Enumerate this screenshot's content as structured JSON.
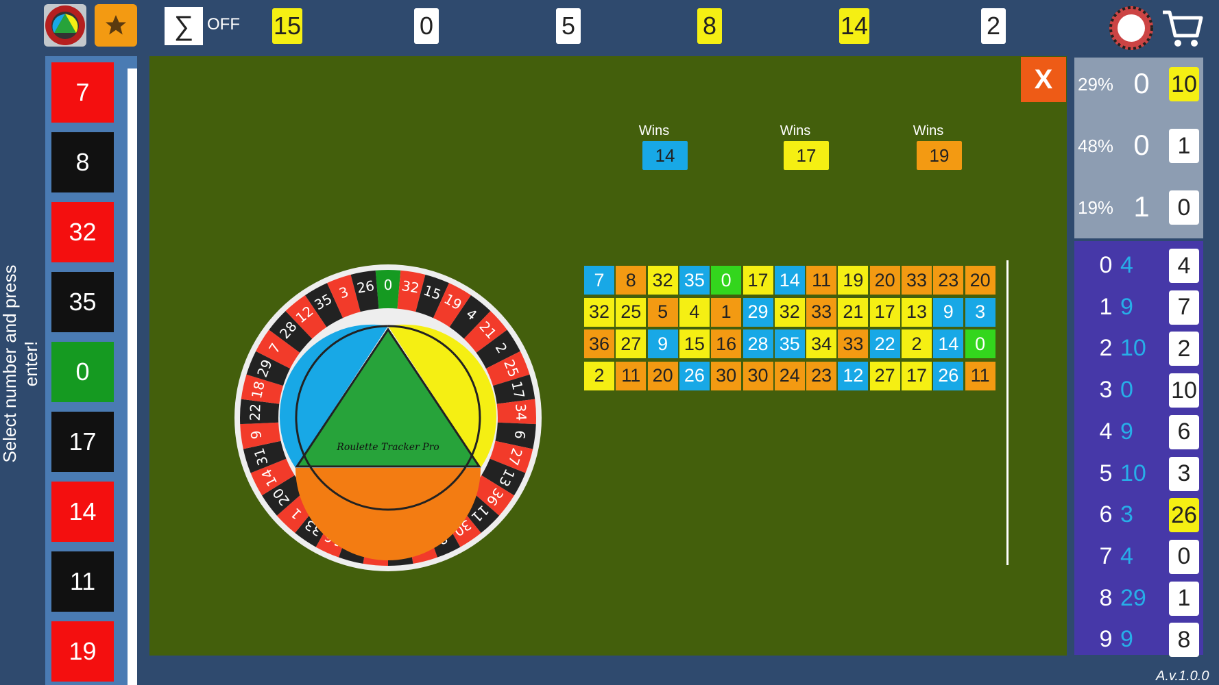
{
  "colors": {
    "red": "#f40f0f",
    "black": "#111111",
    "green": "#159a21",
    "yellow": "#f5ef13",
    "orange": "#f39a12",
    "blue": "#18a8e6",
    "bright_green": "#33d61d",
    "board": "#435f0c",
    "close": "#ee5b16"
  },
  "topbar": {
    "sum_symbol": "∑",
    "sum_state": "OFF",
    "numbers": [
      {
        "value": "15",
        "color": "#f5ef13"
      },
      {
        "value": "0",
        "color": "#ffffff"
      },
      {
        "value": "5",
        "color": "#ffffff"
      },
      {
        "value": "8",
        "color": "#f5ef13"
      },
      {
        "value": "14",
        "color": "#f5ef13"
      },
      {
        "value": "2",
        "color": "#ffffff"
      }
    ]
  },
  "left": {
    "hint": "Select number and press enter!",
    "numbers": [
      {
        "value": "7",
        "color": "#f40f0f"
      },
      {
        "value": "8",
        "color": "#111111"
      },
      {
        "value": "32",
        "color": "#f40f0f"
      },
      {
        "value": "35",
        "color": "#111111"
      },
      {
        "value": "0",
        "color": "#159a21"
      },
      {
        "value": "17",
        "color": "#111111"
      },
      {
        "value": "14",
        "color": "#f40f0f"
      },
      {
        "value": "11",
        "color": "#111111"
      },
      {
        "value": "19",
        "color": "#f40f0f"
      }
    ]
  },
  "board": {
    "close_label": "X",
    "wheel_text": "Roulette Tracker Pro",
    "wins": [
      {
        "label": "Wins",
        "value": "14",
        "color": "#18a8e6"
      },
      {
        "label": "Wins",
        "value": "17",
        "color": "#f5ef13"
      },
      {
        "label": "Wins",
        "value": "19",
        "color": "#f39a12"
      }
    ],
    "grid": [
      [
        [
          "7",
          "b"
        ],
        [
          "8",
          "o"
        ],
        [
          "32",
          "y"
        ],
        [
          "35",
          "b"
        ],
        [
          "0",
          "g"
        ],
        [
          "17",
          "y"
        ],
        [
          "14",
          "b"
        ],
        [
          "11",
          "o"
        ],
        [
          "19",
          "y"
        ],
        [
          "20",
          "o"
        ],
        [
          "33",
          "o"
        ],
        [
          "23",
          "o"
        ],
        [
          "20",
          "o"
        ]
      ],
      [
        [
          "32",
          "y"
        ],
        [
          "25",
          "y"
        ],
        [
          "5",
          "o"
        ],
        [
          "4",
          "y"
        ],
        [
          "1",
          "o"
        ],
        [
          "29",
          "b"
        ],
        [
          "32",
          "y"
        ],
        [
          "33",
          "o"
        ],
        [
          "21",
          "y"
        ],
        [
          "17",
          "y"
        ],
        [
          "13",
          "y"
        ],
        [
          "9",
          "b"
        ],
        [
          "3",
          "b"
        ]
      ],
      [
        [
          "36",
          "o"
        ],
        [
          "27",
          "y"
        ],
        [
          "9",
          "b"
        ],
        [
          "15",
          "y"
        ],
        [
          "16",
          "o"
        ],
        [
          "28",
          "b"
        ],
        [
          "35",
          "b"
        ],
        [
          "34",
          "y"
        ],
        [
          "33",
          "o"
        ],
        [
          "22",
          "b"
        ],
        [
          "2",
          "y"
        ],
        [
          "14",
          "b"
        ],
        [
          "0",
          "g"
        ]
      ],
      [
        [
          "2",
          "y"
        ],
        [
          "11",
          "o"
        ],
        [
          "20",
          "o"
        ],
        [
          "26",
          "b"
        ],
        [
          "30",
          "o"
        ],
        [
          "30",
          "o"
        ],
        [
          "24",
          "o"
        ],
        [
          "23",
          "o"
        ],
        [
          "12",
          "b"
        ],
        [
          "27",
          "y"
        ],
        [
          "17",
          "y"
        ],
        [
          "26",
          "b"
        ],
        [
          "11",
          "o"
        ]
      ]
    ]
  },
  "stats": {
    "top": [
      {
        "pct": "29%",
        "value": "0",
        "box": "10",
        "box_color": "#f5ef13"
      },
      {
        "pct": "48%",
        "value": "0",
        "box": "1",
        "box_color": "#ffffff"
      },
      {
        "pct": "19%",
        "value": "1",
        "box": "0",
        "box_color": "#ffffff"
      }
    ],
    "digits": [
      {
        "d": "0",
        "count": "4",
        "box": "4",
        "box_color": "#ffffff"
      },
      {
        "d": "1",
        "count": "9",
        "box": "7",
        "box_color": "#ffffff"
      },
      {
        "d": "2",
        "count": "10",
        "box": "2",
        "box_color": "#ffffff"
      },
      {
        "d": "3",
        "count": "0",
        "box": "10",
        "box_color": "#ffffff"
      },
      {
        "d": "4",
        "count": "9",
        "box": "6",
        "box_color": "#ffffff"
      },
      {
        "d": "5",
        "count": "10",
        "box": "3",
        "box_color": "#ffffff"
      },
      {
        "d": "6",
        "count": "3",
        "box": "26",
        "box_color": "#f5ef13"
      },
      {
        "d": "7",
        "count": "4",
        "box": "0",
        "box_color": "#ffffff"
      },
      {
        "d": "8",
        "count": "29",
        "box": "1",
        "box_color": "#ffffff"
      },
      {
        "d": "9",
        "count": "9",
        "box": "8",
        "box_color": "#ffffff"
      }
    ]
  },
  "version": "A.v.1.0.0"
}
